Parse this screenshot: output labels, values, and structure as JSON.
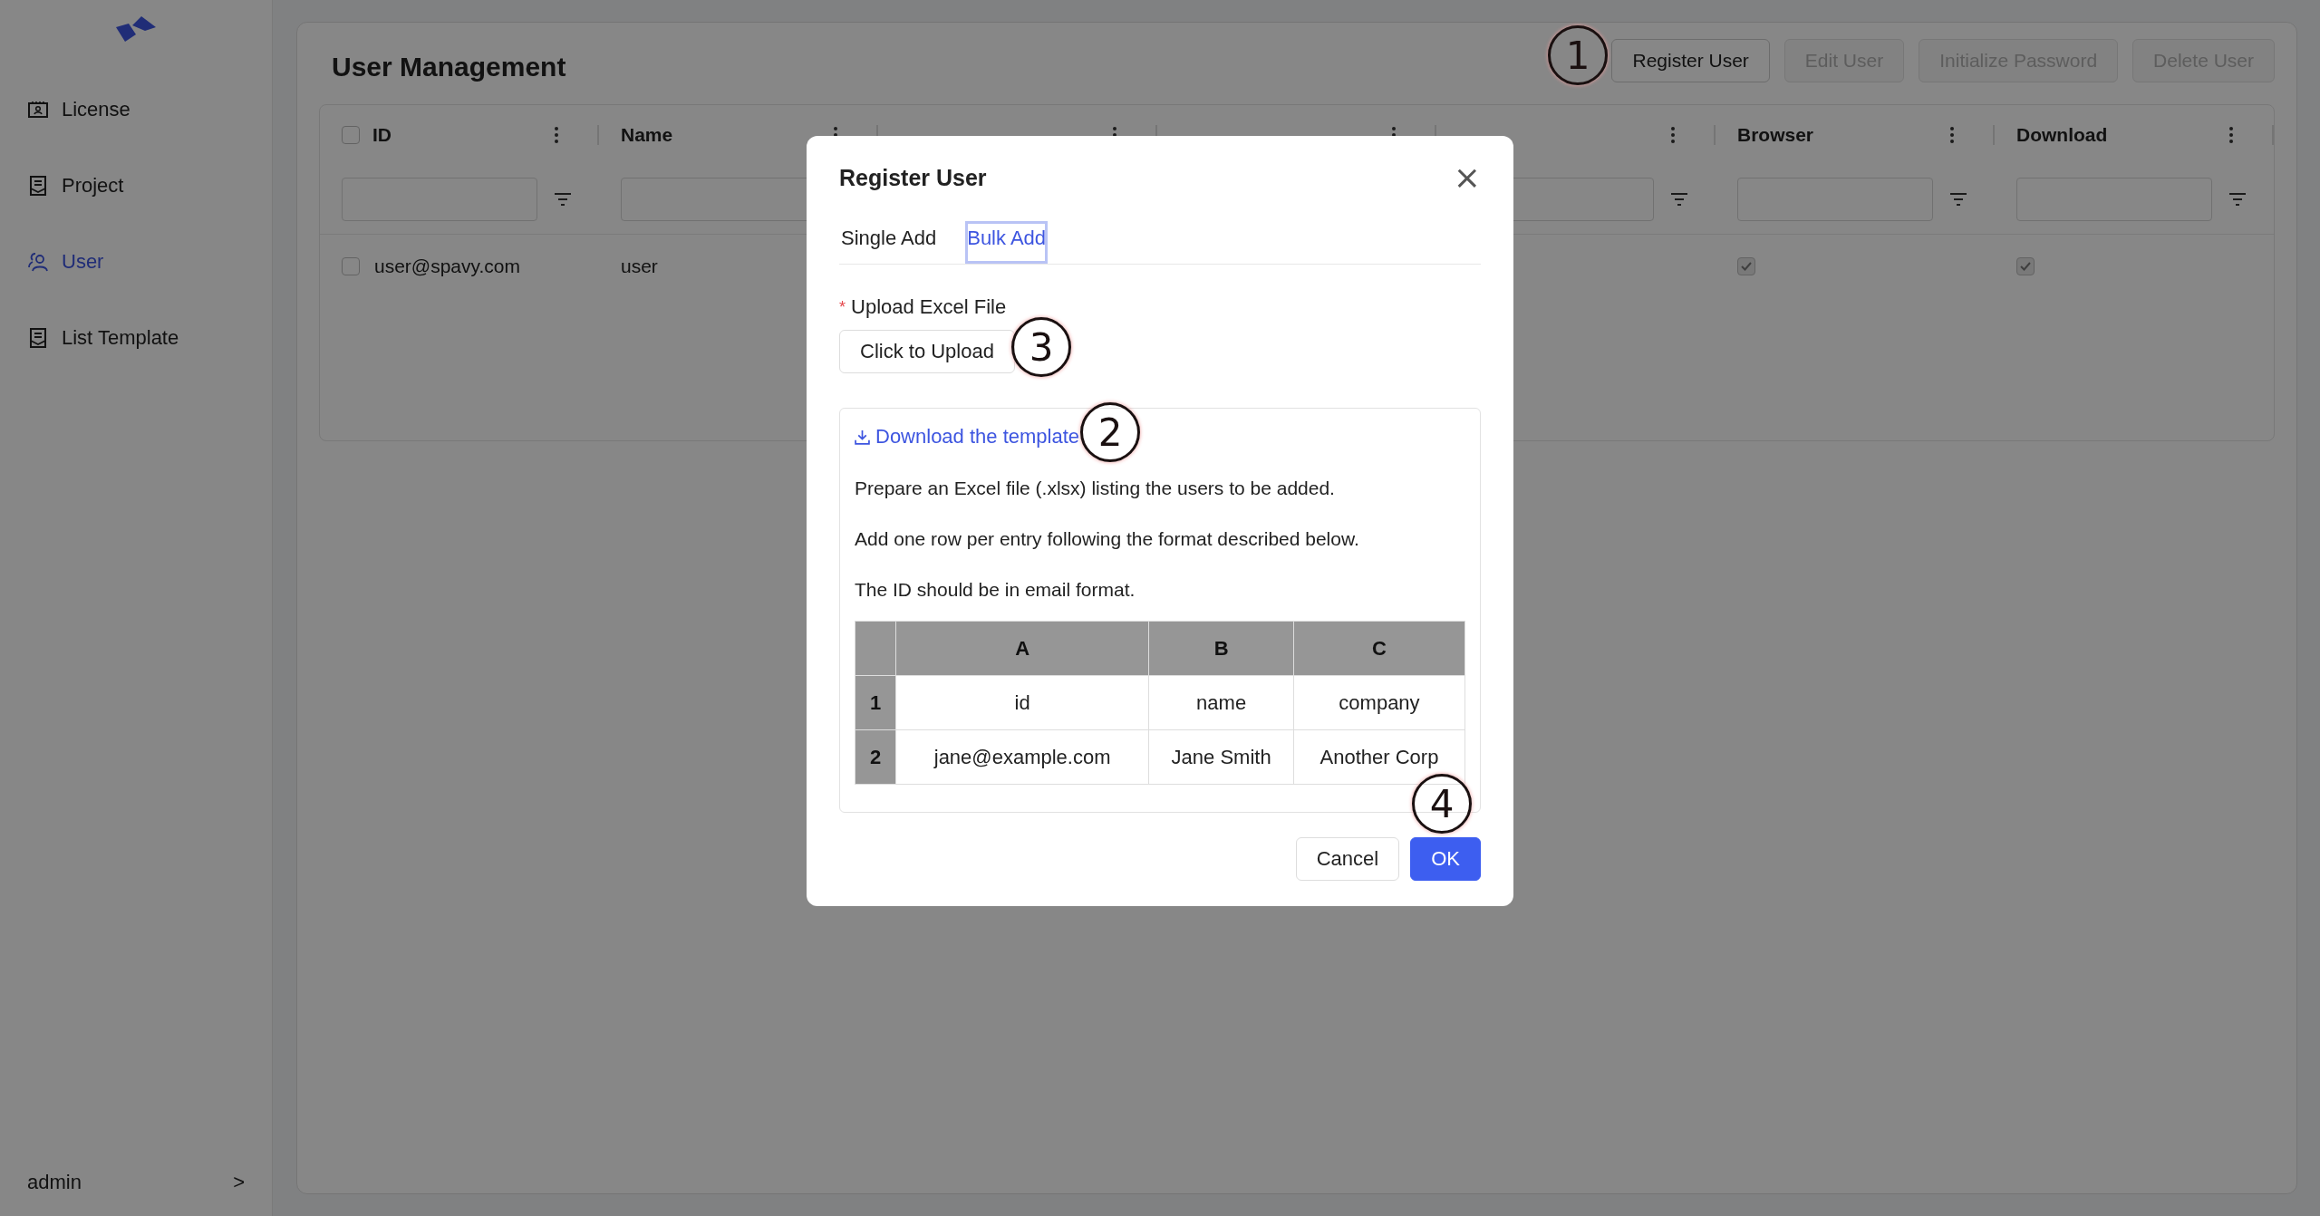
{
  "sidebar": {
    "items": [
      {
        "label": "License",
        "selected": false
      },
      {
        "label": "Project",
        "selected": false
      },
      {
        "label": "User",
        "selected": true
      },
      {
        "label": "List Template",
        "selected": false
      }
    ],
    "account": {
      "label": "admin",
      "chevron": ">"
    }
  },
  "page": {
    "title": "User Management",
    "actions": [
      {
        "label": "Register User",
        "disabled": false
      },
      {
        "label": "Edit User",
        "disabled": true
      },
      {
        "label": "Initialize Password",
        "disabled": true
      },
      {
        "label": "Delete User",
        "disabled": true
      }
    ]
  },
  "table": {
    "all_selected": false,
    "columns": [
      {
        "label": "ID"
      },
      {
        "label": "Name"
      },
      {},
      {},
      {},
      {
        "label": "Browser"
      },
      {
        "label": "Download"
      }
    ],
    "rows": [
      {
        "selected": false,
        "id": "user@spavy.com",
        "name": "user",
        "browser_checked": true,
        "download_checked": true
      }
    ]
  },
  "dialog": {
    "title": "Register User",
    "close": "×",
    "tabs": [
      {
        "label": "Single Add",
        "selected": false
      },
      {
        "label": "Bulk Add",
        "selected": true
      }
    ],
    "upload_label": "Upload Excel File",
    "required_mark": "*",
    "upload_button": "Click to Upload",
    "template_link": "Download the template",
    "instructions": [
      "Prepare an Excel file (.xlsx) listing the users to be added.",
      "Add one row per entry following the format described below.",
      "The ID should be in email format."
    ],
    "sample": {
      "columns": [
        "A",
        "B",
        "C"
      ],
      "rows": [
        {
          "number": "1",
          "cells": [
            "id",
            "name",
            "company"
          ]
        },
        {
          "number": "2",
          "cells": [
            "jane@example.com",
            "Jane Smith",
            "Another Corp"
          ]
        }
      ]
    },
    "buttons": [
      {
        "label": "Cancel",
        "kind": "default"
      },
      {
        "label": "OK",
        "kind": "primary"
      }
    ]
  },
  "markers": [
    {
      "label": "1"
    },
    {
      "label": "2"
    },
    {
      "label": "3"
    },
    {
      "label": "4"
    }
  ]
}
